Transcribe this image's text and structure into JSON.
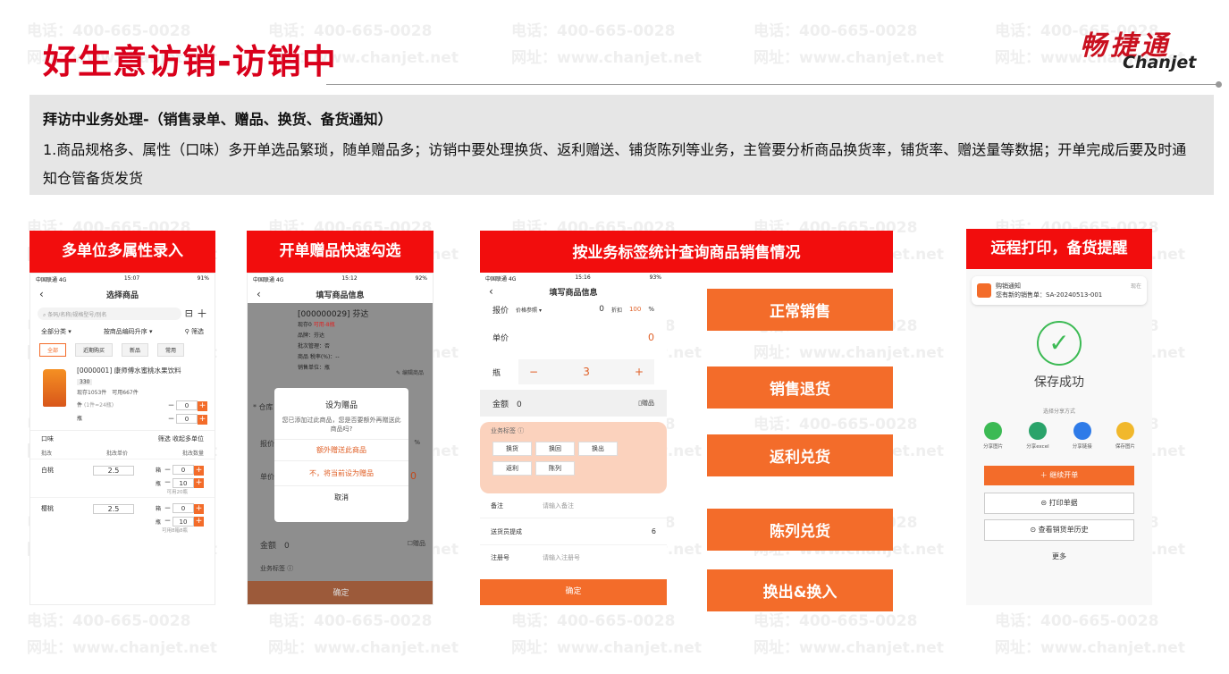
{
  "watermark": {
    "phone": "电话：400-665-0028",
    "site": "网址：www.chanjet.net"
  },
  "header": {
    "title": "好生意访销-访销中",
    "logo_cn": "畅捷通",
    "logo_en": "Chanjet"
  },
  "desc": {
    "heading": "拜访中业务处理-（销售录单、赠品、换货、备货通知）",
    "body": "1.商品规格多、属性（口味）多开单选品繁琐，随单赠品多；访销中要处理换货、返利赠送、铺货陈列等业务，主管要分析商品换货率，铺货率、赠送量等数据；开单完成后要及时通知仓管备货发货"
  },
  "sections": {
    "s1": "多单位多属性录入",
    "s2": "开单赠品快速勾选",
    "s3": "按业务标签统计查询商品销售情况",
    "s4": "远程打印，备货提醒"
  },
  "biz_buttons": [
    "正常销售",
    "销售退货",
    "返利兑货",
    "陈列兑货",
    "换出&换入"
  ],
  "p1": {
    "carrier": "中国联通 4G",
    "time": "15:07",
    "battery": "91%",
    "nav_title": "选择商品",
    "search_placeholder": "条码/名称/规格型号/别名",
    "filter_all": "全部分类",
    "filter_sort": "按商品编码升序",
    "filter_screen": "筛选",
    "tabs": [
      "全部",
      "近期购买",
      "新品",
      "常用"
    ],
    "product_name": "[0000001] 康师傅水蜜桃水果饮料",
    "product_tag": "330",
    "stock": "现存1053件　可用667件",
    "pack_label": "件",
    "pack_sub": "(1件=24瓶)",
    "unit_ping": "瓶",
    "attr_label": "口味",
    "attr_filter": "筛选 收起多单位",
    "col1": "批改",
    "col2": "批改单价",
    "col3": "批改数量",
    "flavors": [
      {
        "name": "白桃",
        "price": "2.5",
        "box": "0",
        "bottle": "10",
        "avail": "可用20瓶"
      },
      {
        "name": "樱桃",
        "price": "2.5",
        "box": "0",
        "bottle": "10",
        "avail": "可用8箱8瓶"
      }
    ],
    "unit_box": "箱",
    "qty_zero": "0",
    "qty_ten": "10"
  },
  "p2": {
    "carrier": "中国联通 4G",
    "time": "15:12",
    "battery": "92%",
    "nav_title": "填写商品信息",
    "product": "[000000029] 芬达",
    "p_price_label": "现存0",
    "p_price": "可用-8瓶",
    "p_brand": "品牌：芬达",
    "p_batch": "批次管理：否",
    "p_tax": "商品 税率(%)：--",
    "p_unit": "销售单位：瓶",
    "edit": "编辑商品",
    "dialog_title": "设为赠品",
    "dialog_msg": "您已添加过此商品，您是否要额外再赠送此商品吗?",
    "opt1": "额外赠送此商品",
    "opt2": "不，将当前设为赠品",
    "cancel": "取消",
    "side_warehouse": "仓库",
    "side_quote": "报价",
    "side_unit": "单价",
    "side_pct": "%",
    "side_zero": "0",
    "amount_label": "金额",
    "amount_val": "0",
    "gift": "赠品",
    "biz_tag": "业务标签",
    "confirm": "确定"
  },
  "p3": {
    "carrier": "中国联通 4G",
    "time": "15:16",
    "battery": "93%",
    "nav_title": "填写商品信息",
    "quote_label": "报价",
    "quote_ref": "价格参照",
    "quote_val": "0",
    "discount_label": "折扣",
    "discount_val": "100",
    "pct": "%",
    "unit_price_label": "单价",
    "unit_price_val": "0",
    "unit_label": "瓶",
    "qty": "3",
    "amount_label": "金额",
    "amount_val": "0",
    "gift": "赠品",
    "biz_tag": "业务标签",
    "tags": [
      "换货",
      "换回",
      "换出",
      "返利",
      "陈列"
    ],
    "note_label": "备注",
    "note_ph": "请输入备注",
    "deliver_label": "送货员提成",
    "deliver_val": "6",
    "reg_label": "注册号",
    "reg_ph": "请输入注册号",
    "confirm": "确定"
  },
  "p4": {
    "notif_app": "购销通知",
    "notif_time": "现在",
    "notif_msg": "您有新的销售单：SA-20240513-001",
    "saved": "保存成功",
    "share_title": "选择分享方式",
    "share": [
      "分享图片",
      "分享excel",
      "分享链接",
      "保存图片"
    ],
    "continue": "＋ 继续开单",
    "print": "⊝ 打印单据",
    "history": "⊙ 查看销货单历史",
    "more": "更多"
  },
  "colors": {
    "red": "#f20d0d",
    "orange": "#f36c2a",
    "brand_red": "#d9001b"
  }
}
